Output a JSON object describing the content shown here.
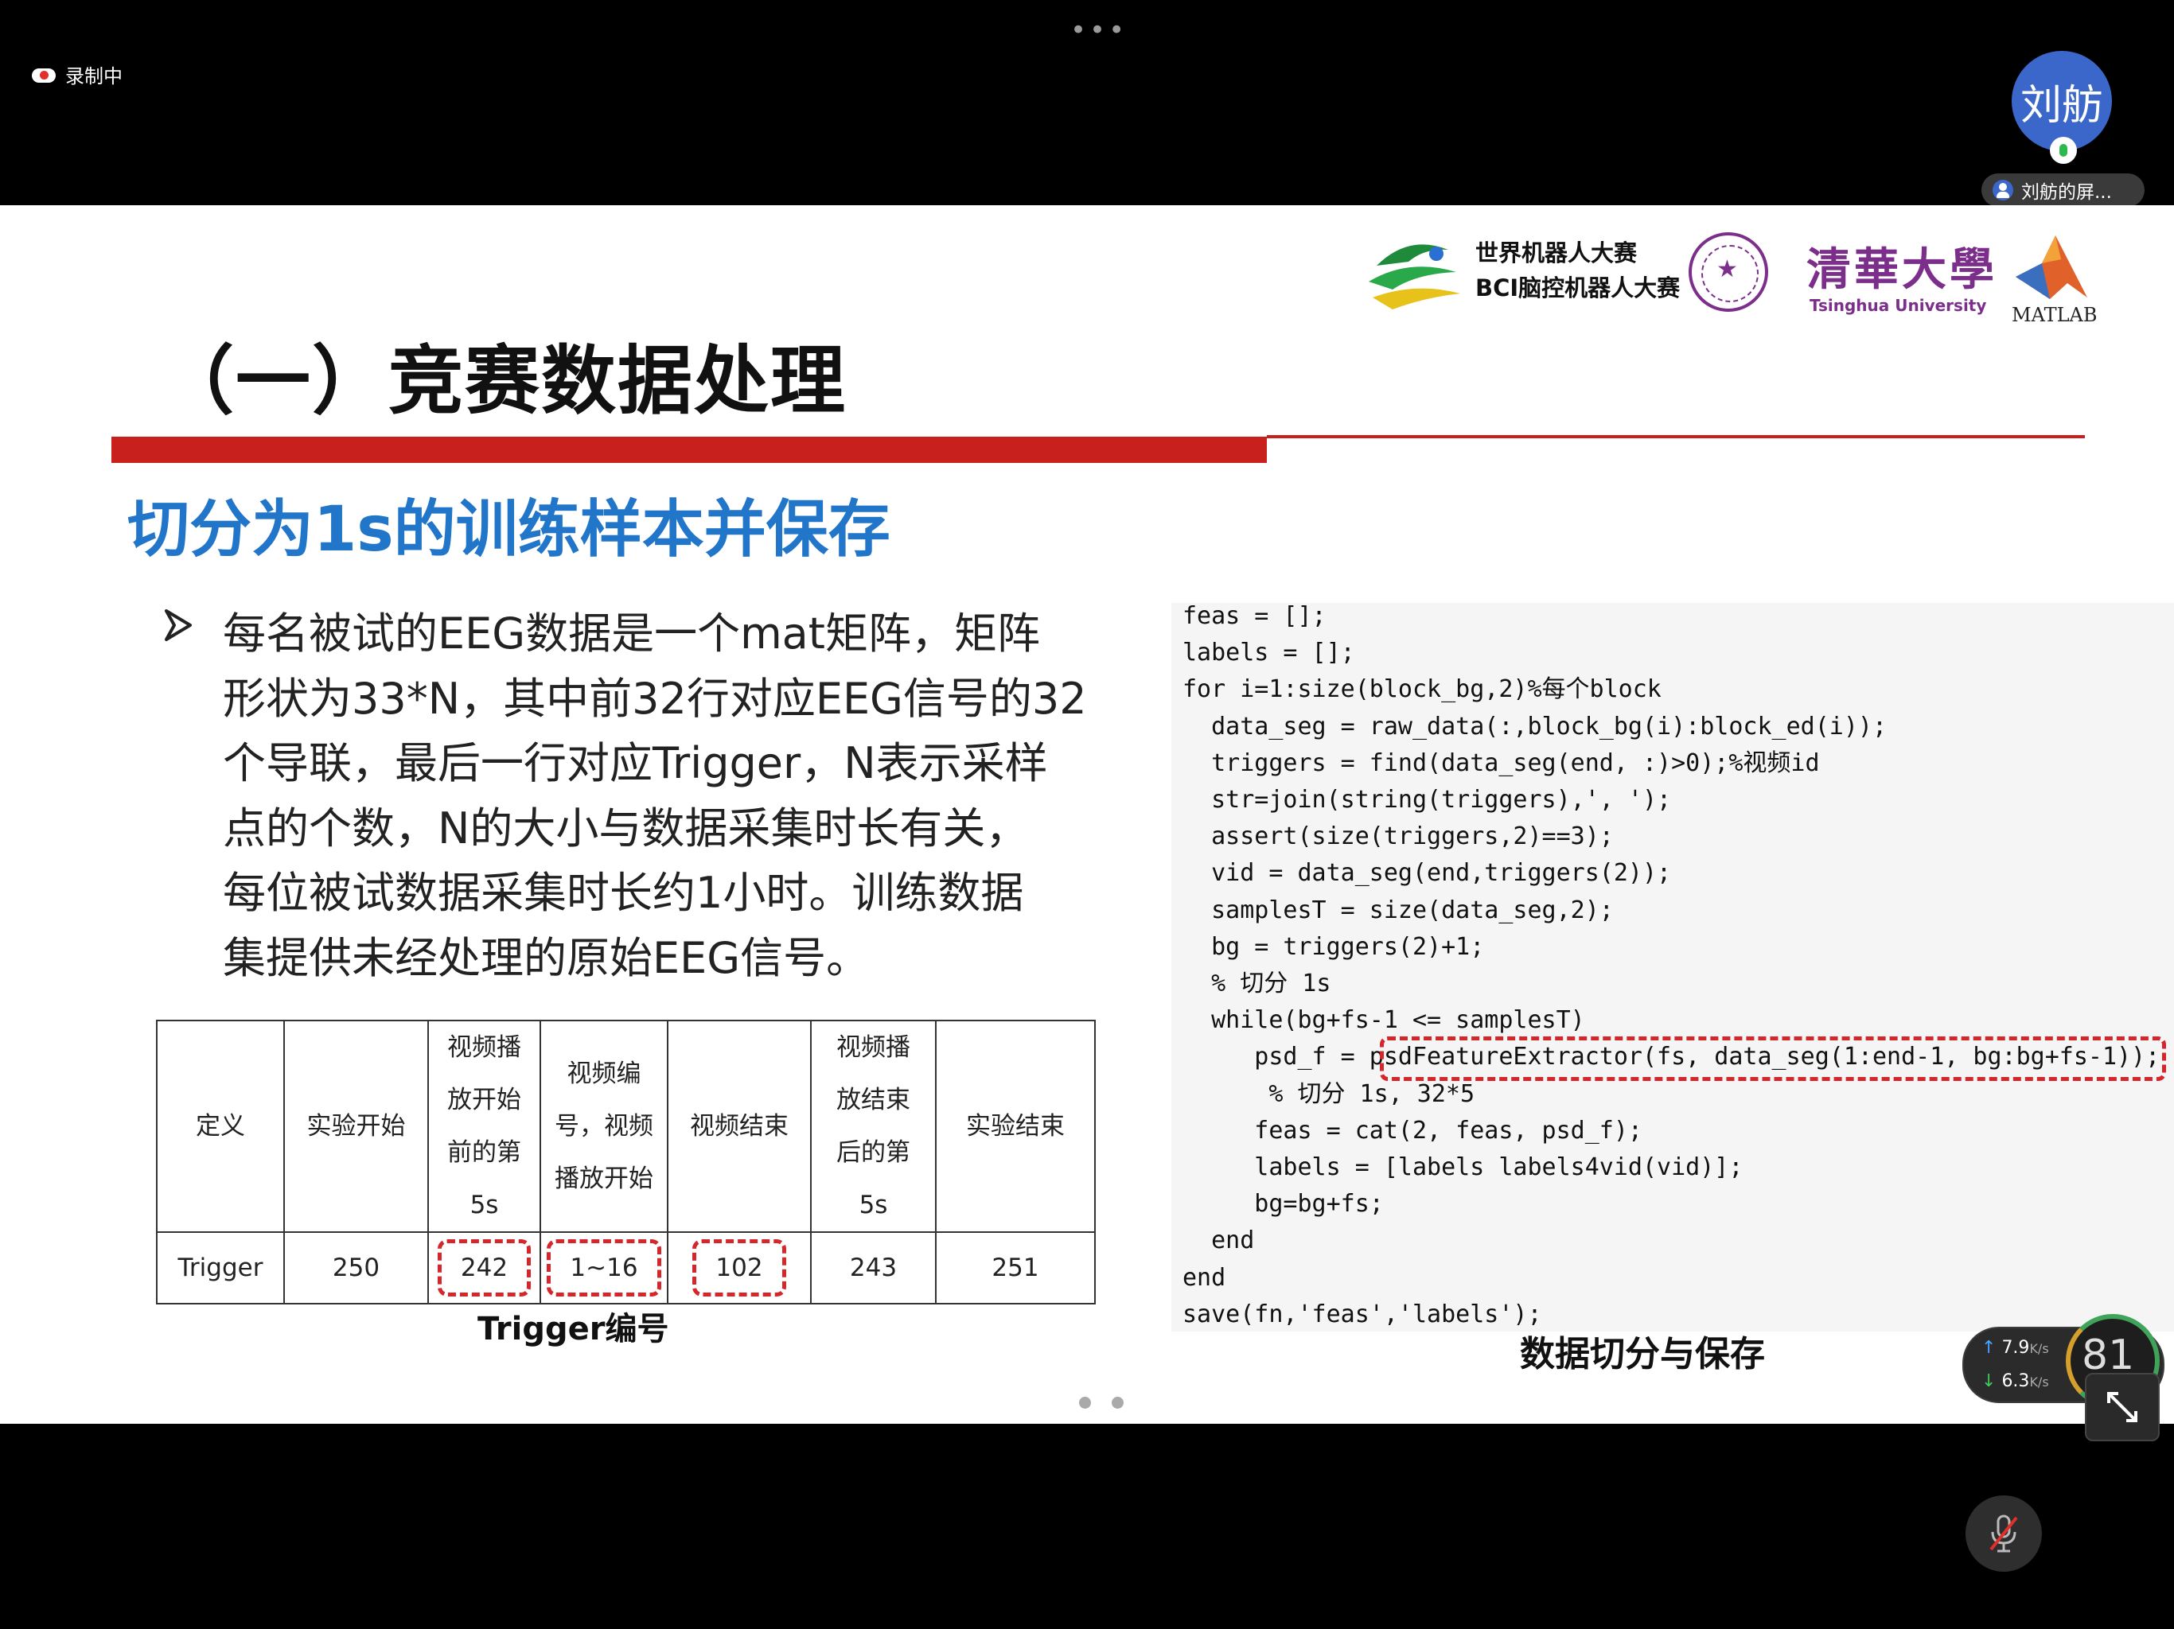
{
  "topbar": {
    "menu_dots": "•••",
    "recording_label": "录制中"
  },
  "participant": {
    "avatar_name": "刘舫",
    "share_label": "刘舫的屏..."
  },
  "slide": {
    "logos": {
      "wrc_line1": "世界机器人大赛",
      "wrc_line2": "BCI脑控机器人大赛",
      "tsinghua_cn": "清華大學",
      "tsinghua_en": "Tsinghua University",
      "matlab": "MATLAB"
    },
    "title": "（一）竞赛数据处理",
    "subtitle": "切分为1s的训练样本并保存",
    "paragraph": "每名被试的EEG数据是一个mat矩阵，矩阵形状为33*N，其中前32行对应EEG信号的32个导联，最后一行对应Trigger，N表示采样点的个数，N的大小与数据采集时长有关，每位被试数据采集时长约1小时。训练数据集提供未经处理的原始EEG信号。",
    "paragraph_lines": [
      "每名被试的EEG数据是一个mat矩阵，矩阵",
      "形状为33*N，其中前32行对应EEG信号的32",
      "个导联，最后一行对应Trigger，N表示采样",
      "点的个数，N的大小与数据采集时长有关，",
      "每位被试数据采集时长约1小时。训练数据",
      "集提供未经处理的原始EEG信号。"
    ],
    "table": {
      "header": [
        "定义",
        "实验开始",
        "视频播放开始前的第5s",
        "视频编号，视频播放开始",
        "视频结束",
        "视频播放结束后的第5s",
        "实验结束"
      ],
      "header_lines": [
        [
          "定义"
        ],
        [
          "实验开始"
        ],
        [
          "视频播",
          "放开始",
          "前的第",
          "5s"
        ],
        [
          "视频编",
          "号，视频",
          "播放开始"
        ],
        [
          "视频结束"
        ],
        [
          "视频播",
          "放结束",
          "后的第",
          "5s"
        ],
        [
          "实验结束"
        ]
      ],
      "row": [
        "Trigger",
        "250",
        "242",
        "1~16",
        "102",
        "243",
        "251"
      ],
      "caption": "Trigger编号"
    },
    "code_lines": [
      "feas = [];",
      "labels = [];",
      "for i=1:size(block_bg,2)%每个block",
      "  data_seg = raw_data(:,block_bg(i):block_ed(i));",
      "  triggers = find(data_seg(end, :)>0);%视频id",
      "  str=join(string(triggers),', ');",
      "  assert(size(triggers,2)==3);",
      "  vid = data_seg(end,triggers(2));",
      "  samplesT = size(data_seg,2);",
      "  bg = triggers(2)+1;",
      "  % 切分 1s",
      "  while(bg+fs-1 <= samplesT)",
      "     psd_f = psdFeatureExtractor(fs, data_seg(1:end-1, bg:bg+fs-1));",
      "      % 切分 1s, 32*5",
      "     feas = cat(2, feas, psd_f);",
      "     labels = [labels labels4vid(vid)];",
      "     bg=bg+fs;",
      "  end",
      "end",
      "save(fn,'feas','labels');"
    ],
    "code_caption": "数据切分与保存",
    "page_dots": 2
  },
  "network": {
    "upload": "7.9",
    "download": "6.3",
    "unit": "K/s",
    "gauge_value": "81"
  },
  "colors": {
    "title_bar_red": "#c8201d",
    "subtitle_blue": "#2176c9",
    "highlight_dash_red": "#d4262b",
    "avatar_blue": "#3a67c9"
  }
}
